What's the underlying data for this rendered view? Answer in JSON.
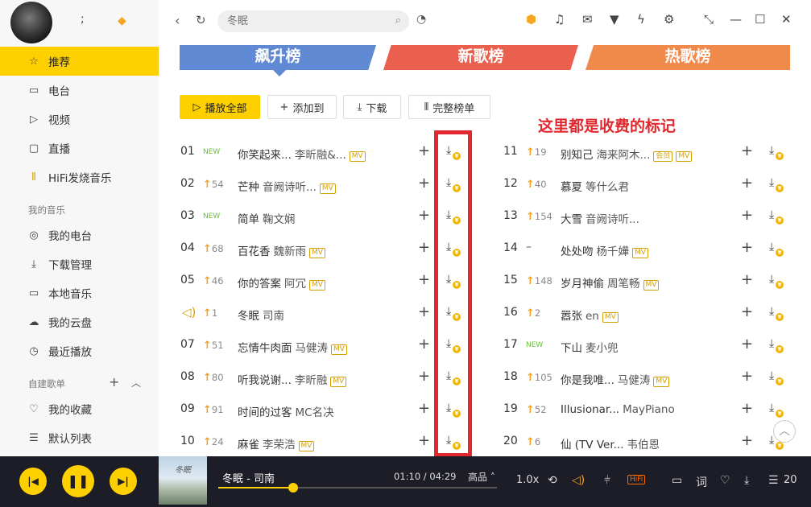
{
  "profile": {
    "name": ";"
  },
  "sidebar": {
    "items": [
      {
        "label": "推荐",
        "icon": "star-icon"
      },
      {
        "label": "电台",
        "icon": "radio-icon"
      },
      {
        "label": "视频",
        "icon": "video-icon"
      },
      {
        "label": "直播",
        "icon": "live-icon"
      },
      {
        "label": "HiFi发烧音乐",
        "icon": "hifi-icon"
      }
    ],
    "section_my_music": "我的音乐",
    "my_music_items": [
      {
        "label": "我的电台",
        "icon": "podcast-icon"
      },
      {
        "label": "下载管理",
        "icon": "download-icon"
      },
      {
        "label": "本地音乐",
        "icon": "monitor-icon"
      },
      {
        "label": "我的云盘",
        "icon": "cloud-icon"
      },
      {
        "label": "最近播放",
        "icon": "clock-icon"
      }
    ],
    "section_playlists": "自建歌单",
    "playlist_items": [
      {
        "label": "我的收藏",
        "icon": "heart-icon"
      },
      {
        "label": "默认列表",
        "icon": "list-icon"
      }
    ]
  },
  "search": {
    "placeholder": "冬眠"
  },
  "tabs": {
    "rise": "飙升榜",
    "new": "新歌榜",
    "hot": "热歌榜"
  },
  "toolbar": {
    "play_all": "播放全部",
    "add_to": "添加到",
    "download": "下载",
    "full_chart": "完整榜单"
  },
  "annotation": "这里都是收费的标记",
  "left_songs": [
    {
      "rank": "01",
      "change": "NEW",
      "type": "new",
      "title": "你笑起来...",
      "artist": "李昕融&...",
      "tag": "MV"
    },
    {
      "rank": "02",
      "change": "54",
      "type": "up",
      "title": "芒种",
      "artist": "音阙诗听...",
      "tag": "MV"
    },
    {
      "rank": "03",
      "change": "NEW",
      "type": "new",
      "title": "简单",
      "artist": "鞠文娴",
      "tag": ""
    },
    {
      "rank": "04",
      "change": "68",
      "type": "up",
      "title": "百花香",
      "artist": "魏新雨",
      "tag": "MV"
    },
    {
      "rank": "05",
      "change": "46",
      "type": "up",
      "title": "你的答案",
      "artist": "阿冗",
      "tag": "MV"
    },
    {
      "rank": "",
      "change": "1",
      "type": "playing",
      "title": "冬眠",
      "artist": "司南",
      "tag": ""
    },
    {
      "rank": "07",
      "change": "51",
      "type": "up",
      "title": "忘情牛肉面",
      "artist": "马健涛",
      "tag": "MV"
    },
    {
      "rank": "08",
      "change": "80",
      "type": "up",
      "title": "听我说谢...",
      "artist": "李昕融",
      "tag": "MV"
    },
    {
      "rank": "09",
      "change": "91",
      "type": "up",
      "title": "时间的过客",
      "artist": "MC名决",
      "tag": ""
    },
    {
      "rank": "10",
      "change": "24",
      "type": "up",
      "title": "麻雀",
      "artist": "李荣浩",
      "tag": "MV"
    }
  ],
  "right_songs": [
    {
      "rank": "11",
      "change": "19",
      "type": "up",
      "title": "别知己",
      "artist": "海来阿木...",
      "tag": "会员",
      "tag2": "MV"
    },
    {
      "rank": "12",
      "change": "40",
      "type": "up",
      "title": "慕夏",
      "artist": "等什么君",
      "tag": ""
    },
    {
      "rank": "13",
      "change": "154",
      "type": "up",
      "title": "大雪",
      "artist": "音阙诗听...",
      "tag": ""
    },
    {
      "rank": "14",
      "change": "–",
      "type": "flat",
      "title": "处处吻",
      "artist": "杨千嬅",
      "tag": "MV"
    },
    {
      "rank": "15",
      "change": "148",
      "type": "up",
      "title": "岁月神偷",
      "artist": "周笔畅",
      "tag": "MV"
    },
    {
      "rank": "16",
      "change": "2",
      "type": "up",
      "title": "嚣张",
      "artist": "en",
      "tag": "MV"
    },
    {
      "rank": "17",
      "change": "NEW",
      "type": "new",
      "title": "下山",
      "artist": "麦小兜",
      "tag": ""
    },
    {
      "rank": "18",
      "change": "105",
      "type": "up",
      "title": "你是我唯...",
      "artist": "马健涛",
      "tag": "MV"
    },
    {
      "rank": "19",
      "change": "52",
      "type": "up",
      "title": "Illusionar...",
      "artist": "MayPiano",
      "tag": ""
    },
    {
      "rank": "20",
      "change": "6",
      "type": "up",
      "title": "仙 (TV Ver...",
      "artist": "韦伯恩",
      "tag": ""
    }
  ],
  "player": {
    "song": "冬眠 - 司南",
    "time": "01:10 / 04:29",
    "progress_fraction": 0.27,
    "quality": "高品",
    "speed": "1.0x",
    "lyrics_label": "词",
    "hifi": "HiFi",
    "playlist_count": "20",
    "cover_text": "冬眠"
  },
  "colors": {
    "accent": "#ffd000",
    "annotation": "#e0282e",
    "rise_tab": "#6089d4",
    "new_tab": "#ea5f4d",
    "hot_tab": "#f08a4b",
    "player_bg": "#1c1d26"
  }
}
